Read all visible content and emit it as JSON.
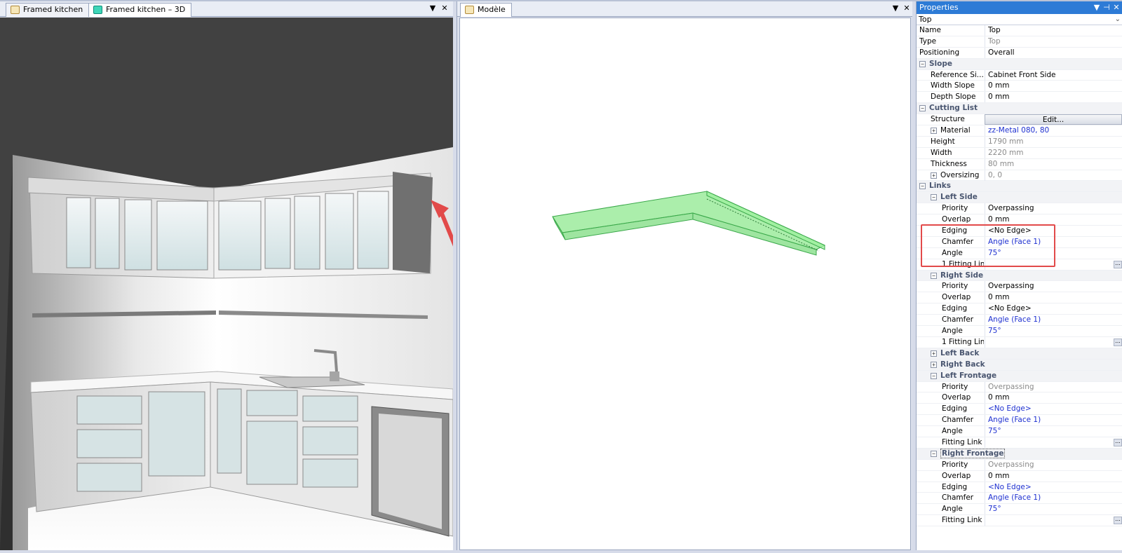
{
  "left_pane": {
    "tabs": [
      {
        "label": "Framed kitchen",
        "active": false
      },
      {
        "label": "Framed kitchen – 3D",
        "active": true
      }
    ],
    "dropdown_glyph": "▼",
    "close_glyph": "✕"
  },
  "mid_pane": {
    "tabs": [
      {
        "label": "Modèle",
        "active": true
      }
    ],
    "dropdown_glyph": "▼",
    "close_glyph": "✕"
  },
  "properties": {
    "title": "Properties",
    "title_controls": [
      "▼",
      "⊣",
      "✕"
    ],
    "object_selector": "Top",
    "rows": [
      {
        "name": "Name",
        "value": "Top",
        "indent": 0,
        "style": ""
      },
      {
        "name": "Type",
        "value": "Top",
        "indent": 0,
        "style": "grey"
      },
      {
        "name": "Positioning",
        "value": "Overall",
        "indent": 0,
        "style": ""
      },
      {
        "name": "Slope",
        "value": "",
        "indent": 0,
        "category": true,
        "expander": "−"
      },
      {
        "name": "Reference Si...",
        "value": "Cabinet Front Side",
        "indent": 1,
        "style": ""
      },
      {
        "name": "Width Slope",
        "value": "0 mm",
        "indent": 1,
        "style": ""
      },
      {
        "name": "Depth Slope",
        "value": "0 mm",
        "indent": 1,
        "style": ""
      },
      {
        "name": "Cutting List",
        "value": "",
        "indent": 0,
        "category": true,
        "expander": "−"
      },
      {
        "name": "Structure",
        "value": "Edit...",
        "indent": 1,
        "style": "btn"
      },
      {
        "name": "Material",
        "value": "zz-Metal 080, 80",
        "indent": 1,
        "style": "blue",
        "expander": "+"
      },
      {
        "name": "Height",
        "value": "1790 mm",
        "indent": 1,
        "style": "grey"
      },
      {
        "name": "Width",
        "value": "2220 mm",
        "indent": 1,
        "style": "grey"
      },
      {
        "name": "Thickness",
        "value": "80 mm",
        "indent": 1,
        "style": "grey"
      },
      {
        "name": "Oversizing",
        "value": "0, 0",
        "indent": 1,
        "style": "grey",
        "expander": "+"
      },
      {
        "name": "Links",
        "value": "",
        "indent": 0,
        "category": true,
        "expander": "−"
      },
      {
        "name": "Left Side",
        "value": "",
        "indent": 1,
        "category": true,
        "expander": "−"
      },
      {
        "name": "Priority",
        "value": "Overpassing",
        "indent": 2,
        "style": ""
      },
      {
        "name": "Overlap",
        "value": "0 mm",
        "indent": 2,
        "style": ""
      },
      {
        "name": "Edging",
        "value": "<No Edge>",
        "indent": 2,
        "style": ""
      },
      {
        "name": "Chamfer",
        "value": "Angle (Face 1)",
        "indent": 2,
        "style": "blue"
      },
      {
        "name": "Angle",
        "value": "75°",
        "indent": 2,
        "style": "blue"
      },
      {
        "name": "1 Fitting Link",
        "value": "",
        "indent": 2,
        "style": "",
        "ellipsis": true
      },
      {
        "name": "Right Side",
        "value": "",
        "indent": 1,
        "category": true,
        "expander": "−"
      },
      {
        "name": "Priority",
        "value": "Overpassing",
        "indent": 2,
        "style": ""
      },
      {
        "name": "Overlap",
        "value": "0 mm",
        "indent": 2,
        "style": ""
      },
      {
        "name": "Edging",
        "value": "<No Edge>",
        "indent": 2,
        "style": ""
      },
      {
        "name": "Chamfer",
        "value": "Angle (Face 1)",
        "indent": 2,
        "style": "blue"
      },
      {
        "name": "Angle",
        "value": "75°",
        "indent": 2,
        "style": "blue"
      },
      {
        "name": "1 Fitting Link",
        "value": "",
        "indent": 2,
        "style": "",
        "ellipsis": true
      },
      {
        "name": "Left Back",
        "value": "",
        "indent": 1,
        "category": true,
        "expander": "+"
      },
      {
        "name": "Right Back",
        "value": "",
        "indent": 1,
        "category": true,
        "expander": "+"
      },
      {
        "name": "Left Frontage",
        "value": "",
        "indent": 1,
        "category": true,
        "expander": "−"
      },
      {
        "name": "Priority",
        "value": "Overpassing",
        "indent": 2,
        "style": "grey"
      },
      {
        "name": "Overlap",
        "value": "0 mm",
        "indent": 2,
        "style": ""
      },
      {
        "name": "Edging",
        "value": "<No Edge>",
        "indent": 2,
        "style": "blue"
      },
      {
        "name": "Chamfer",
        "value": "Angle (Face 1)",
        "indent": 2,
        "style": "blue"
      },
      {
        "name": "Angle",
        "value": "75°",
        "indent": 2,
        "style": "blue"
      },
      {
        "name": "Fitting Link",
        "value": "",
        "indent": 2,
        "style": "",
        "ellipsis": true
      },
      {
        "name": "Right Frontage",
        "value": "",
        "indent": 1,
        "category": true,
        "expander": "−",
        "selected": true
      },
      {
        "name": "Priority",
        "value": "Overpassing",
        "indent": 2,
        "style": "grey"
      },
      {
        "name": "Overlap",
        "value": "0 mm",
        "indent": 2,
        "style": ""
      },
      {
        "name": "Edging",
        "value": "<No Edge>",
        "indent": 2,
        "style": "blue"
      },
      {
        "name": "Chamfer",
        "value": "Angle (Face 1)",
        "indent": 2,
        "style": "blue"
      },
      {
        "name": "Angle",
        "value": "75°",
        "indent": 2,
        "style": "blue"
      },
      {
        "name": "Fitting Link",
        "value": "",
        "indent": 2,
        "style": "",
        "ellipsis": true
      }
    ],
    "ellipsis_glyph": "..."
  },
  "colors": {
    "title_bar": "#2d7bd6",
    "highlight": "#e24a4a",
    "model_fill": "#8fe88f",
    "model_stroke": "#3aa84a",
    "value_blue": "#1d2fd0"
  }
}
